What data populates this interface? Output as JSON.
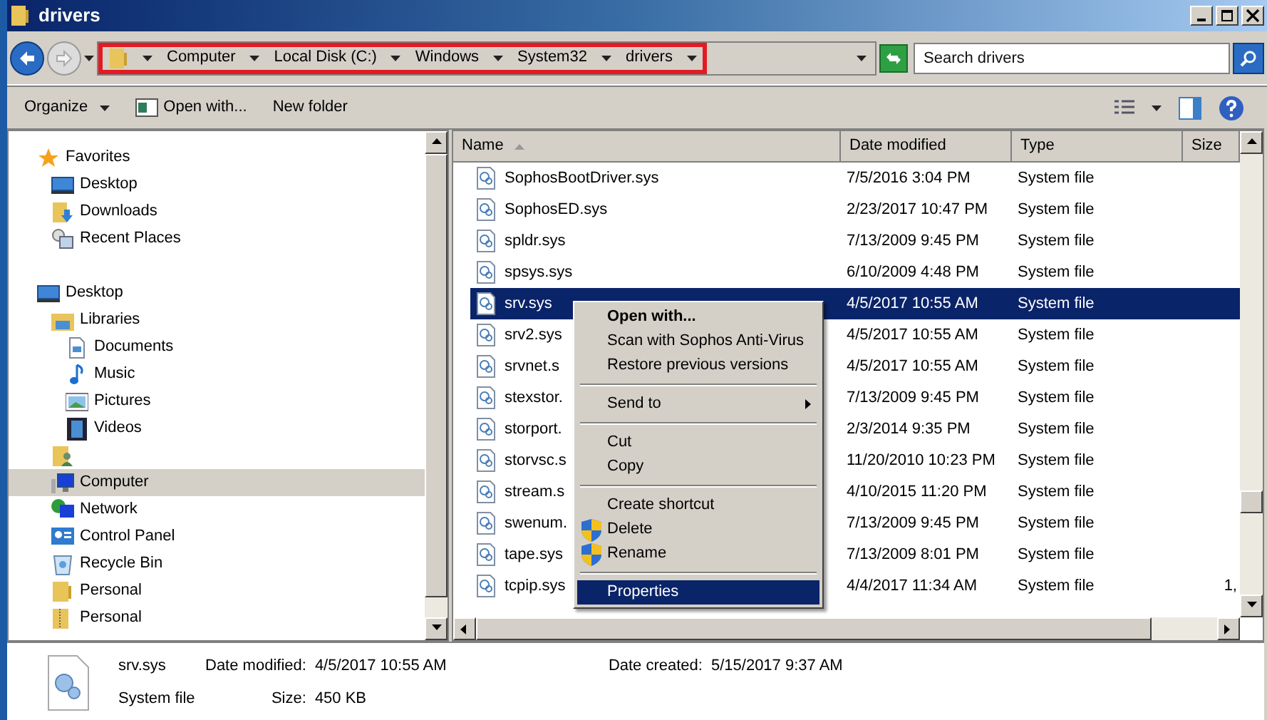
{
  "window": {
    "title": "drivers"
  },
  "address_bar": {
    "crumbs": [
      "Computer",
      "Local Disk (C:)",
      "Windows",
      "System32",
      "drivers"
    ]
  },
  "search": {
    "placeholder": "Search drivers"
  },
  "toolbar": {
    "organize": "Organize",
    "open_with": "Open with...",
    "new_folder": "New folder"
  },
  "nav": [
    {
      "label": "Favorites",
      "kind": "star",
      "selected": false,
      "children": [
        {
          "label": "Desktop",
          "kind": "desktop",
          "selected": false
        },
        {
          "label": "Downloads",
          "kind": "downloads",
          "selected": false
        },
        {
          "label": "Recent Places",
          "kind": "recent",
          "selected": false
        }
      ]
    },
    {
      "label": "Desktop",
      "kind": "desktop",
      "selected": false,
      "children": [
        {
          "label": "Libraries",
          "kind": "libraries",
          "selected": false,
          "children": [
            {
              "label": "Documents",
              "kind": "document",
              "selected": false
            },
            {
              "label": "Music",
              "kind": "music",
              "selected": false
            },
            {
              "label": "Pictures",
              "kind": "pictures",
              "selected": false
            },
            {
              "label": "Videos",
              "kind": "videos",
              "selected": false
            }
          ]
        },
        {
          "kind": "user",
          "selected": false
        },
        {
          "label": "Computer",
          "kind": "computer",
          "selected": true
        },
        {
          "label": "Network",
          "kind": "network",
          "selected": false
        },
        {
          "label": "Control Panel",
          "kind": "control",
          "selected": false
        },
        {
          "label": "Recycle Bin",
          "kind": "recycle",
          "selected": false
        },
        {
          "label": "Personal",
          "kind": "folder",
          "selected": false
        },
        {
          "label": "Personal",
          "kind": "zipfolder",
          "selected": false
        }
      ]
    }
  ],
  "table": {
    "columns": [
      "Name",
      "Date modified",
      "Type",
      "Size"
    ],
    "rows": [
      {
        "name": "SophosBootDriver.sys",
        "date": "7/5/2016 3:04 PM",
        "type": "System file",
        "selected": false
      },
      {
        "name": "SophosED.sys",
        "date": "2/23/2017 10:47 PM",
        "type": "System file",
        "selected": false
      },
      {
        "name": "spldr.sys",
        "date": "7/13/2009 9:45 PM",
        "type": "System file",
        "selected": false
      },
      {
        "name": "spsys.sys",
        "date": "6/10/2009 4:48 PM",
        "type": "System file",
        "selected": false
      },
      {
        "name": "srv.sys",
        "date": "4/5/2017 10:55 AM",
        "type": "System file",
        "selected": true
      },
      {
        "name": "srv2.sys",
        "date": "4/5/2017 10:55 AM",
        "type": "System file",
        "selected": false
      },
      {
        "name": "srvnet.s",
        "date": "4/5/2017 10:55 AM",
        "type": "System file",
        "selected": false
      },
      {
        "name": "stexstor.",
        "date": "7/13/2009 9:45 PM",
        "type": "System file",
        "selected": false
      },
      {
        "name": "storport.",
        "date": "2/3/2014 9:35 PM",
        "type": "System file",
        "selected": false
      },
      {
        "name": "storvsc.s",
        "date": "11/20/2010 10:23 PM",
        "type": "System file",
        "selected": false
      },
      {
        "name": "stream.s",
        "date": "4/10/2015 11:20 PM",
        "type": "System file",
        "selected": false
      },
      {
        "name": "swenum.",
        "date": "7/13/2009 9:45 PM",
        "type": "System file",
        "selected": false
      },
      {
        "name": "tape.sys",
        "date": "7/13/2009 8:01 PM",
        "type": "System file",
        "selected": false
      },
      {
        "name": "tcpip.sys",
        "date": "4/4/2017 11:34 AM",
        "type": "System file",
        "size": "1,",
        "selected": false
      }
    ]
  },
  "context_menu": [
    [
      {
        "label": "Open with...",
        "bold": true,
        "selected": false
      },
      {
        "label": "Scan with Sophos Anti-Virus",
        "selected": false
      },
      {
        "label": "Restore previous versions",
        "selected": false
      }
    ],
    [
      {
        "label": "Send to",
        "submenu": true,
        "selected": false
      }
    ],
    [
      {
        "label": "Cut",
        "selected": false
      },
      {
        "label": "Copy",
        "selected": false
      }
    ],
    [
      {
        "label": "Create shortcut",
        "selected": false
      },
      {
        "label": "Delete",
        "elevated": true,
        "selected": false
      },
      {
        "label": "Rename",
        "elevated": true,
        "selected": false
      }
    ],
    [
      {
        "label": "Properties",
        "selected": true
      }
    ]
  ],
  "details": {
    "name": "srv.sys",
    "type": "System file",
    "fields": [
      {
        "label": "Date modified:",
        "value": "4/5/2017 10:55 AM"
      },
      {
        "label": "Size:",
        "value": "450 KB"
      },
      {
        "label": "Date created:",
        "value": "5/15/2017 9:37 AM"
      }
    ]
  }
}
